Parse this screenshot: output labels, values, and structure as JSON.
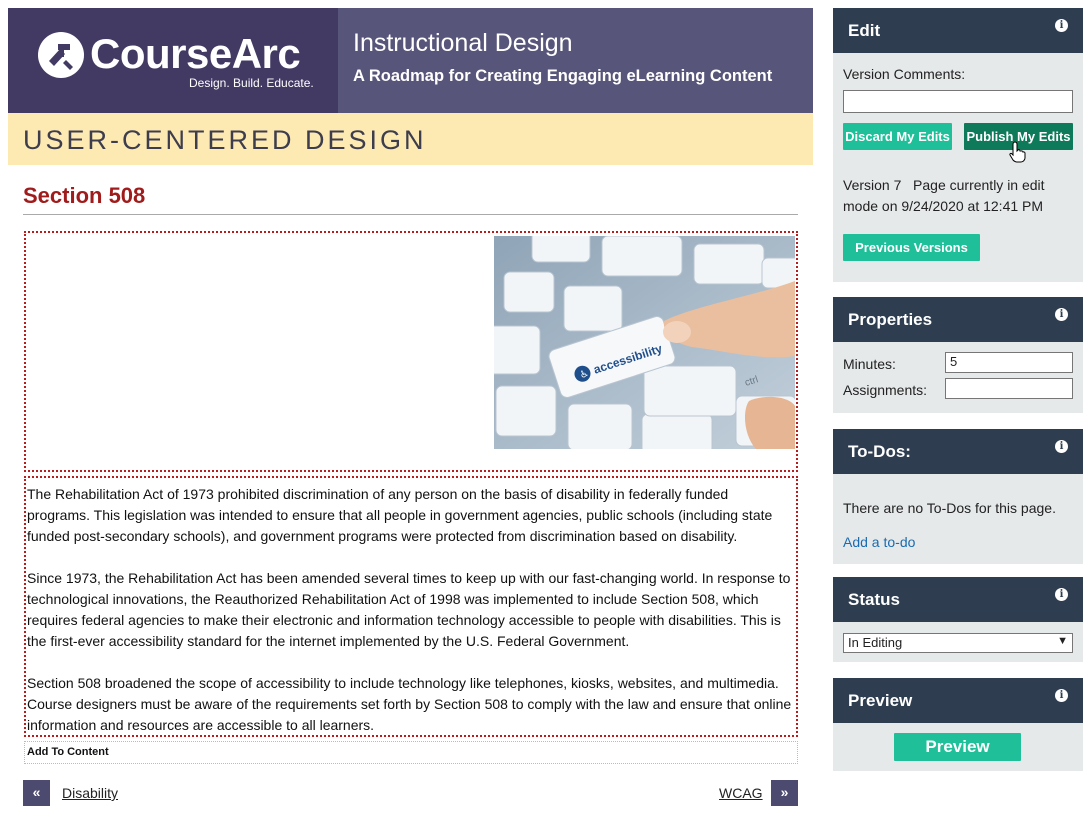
{
  "header": {
    "logo_name": "CourseArc",
    "logo_tagline": "Design. Build. Educate.",
    "course_title": "Instructional Design",
    "course_subtitle": "A Roadmap for Creating Engaging eLearning Content",
    "module_title": "USER-CENTERED DESIGN"
  },
  "page": {
    "title": "Section 508",
    "image_key_text": "accessibility",
    "image_key_label": "ctrl",
    "paragraphs": [
      "The Rehabilitation Act of 1973 prohibited discrimination of any person on the basis of disability in federally funded programs. This legislation was intended to ensure that all people in government agencies, public schools (including state funded post-secondary schools), and government programs were protected from discrimination based on disability.",
      "Since 1973, the Rehabilitation Act has been amended several times to keep up with our fast-changing world. In response to technological innovations, the Reauthorized Rehabilitation Act of 1998 was implemented to include Section 508, which requires federal agencies to make their electronic and information technology accessible to people with disabilities. This is the first-ever accessibility standard for the internet implemented by the U.S. Federal Government.",
      "Section 508 broadened the scope of accessibility to include technology like telephones, kiosks, websites, and multimedia. Course designers must be aware of the requirements set forth by Section 508 to comply with the law and ensure that online information and resources are accessible to all learners."
    ],
    "add_to_content": "Add To Content"
  },
  "nav": {
    "prev_symbol": "«",
    "prev_label": "Disability",
    "next_symbol": "»",
    "next_label": "WCAG"
  },
  "sidebar": {
    "edit": {
      "title": "Edit",
      "version_comments_label": "Version Comments:",
      "version_comments_value": "",
      "discard_label": "Discard My Edits",
      "publish_label": "Publish My Edits",
      "version_line1": "Version 7   Page currently in edit",
      "version_line2": "mode on 9/24/2020 at 12:41 PM",
      "previous_versions_label": "Previous Versions"
    },
    "properties": {
      "title": "Properties",
      "minutes_label": "Minutes:",
      "minutes_value": "5",
      "assignments_label": "Assignments:",
      "assignments_value": ""
    },
    "todos": {
      "title": "To-Dos:",
      "empty_text": "There are no To-Dos for this page.",
      "add_link": "Add a to-do"
    },
    "status": {
      "title": "Status",
      "selected": "In Editing"
    },
    "preview": {
      "title": "Preview",
      "button_label": "Preview"
    },
    "info_symbol": "i"
  },
  "colors": {
    "brand_purple": "#433a63",
    "header_purple": "#58557a",
    "module_yellow": "#fde9b2",
    "title_red": "#a01c1c",
    "panel_dark": "#2e3e50",
    "panel_light": "#e6e9ea",
    "teal": "#1fbf99",
    "dark_green": "#0f7a5a",
    "link_blue": "#1a6bb0"
  }
}
